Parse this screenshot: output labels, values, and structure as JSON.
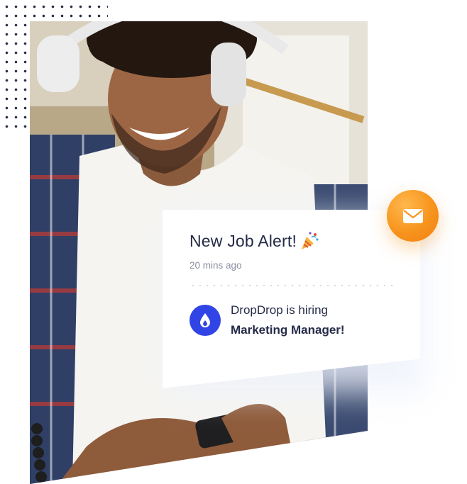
{
  "notification": {
    "title": "New Job Alert!",
    "time": "20 mins ago",
    "message_line1": "DropDrop is hiring",
    "message_line2": "Marketing Manager!",
    "company_icon": "droplet-icon",
    "title_icon": "party-popper-icon"
  },
  "badge": {
    "icon": "envelope-icon"
  },
  "colors": {
    "accent_orange": "#f7941d",
    "company_blue": "#3145e6",
    "title_text": "#252b48",
    "muted_text": "#8b8fa3"
  }
}
